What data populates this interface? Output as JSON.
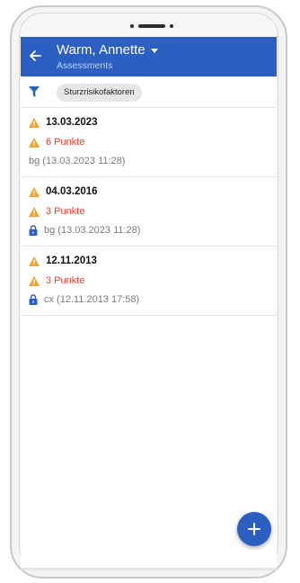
{
  "header": {
    "title": "Warm, Annette",
    "subtitle": "Assessments"
  },
  "filter": {
    "chip_label": "Sturzrisikofaktoren"
  },
  "assessments": [
    {
      "date": "13.03.2023",
      "points": "6 Punkte",
      "meta": "bg (13.03.2023 11:28)",
      "locked": false
    },
    {
      "date": "04.03.2016",
      "points": "3 Punkte",
      "meta": "bg (13.03.2023 11:28)",
      "locked": true
    },
    {
      "date": "12.11.2013",
      "points": "3 Punkte",
      "meta": "cx (12.11.2013 17:58)",
      "locked": true
    }
  ],
  "colors": {
    "primary": "#2b5fc1",
    "warning": "#f0a42b",
    "danger": "#e3402a"
  },
  "icons": [
    "back-arrow-icon",
    "chevron-down-icon",
    "filter-icon",
    "warning-icon",
    "lock-icon",
    "plus-icon"
  ]
}
